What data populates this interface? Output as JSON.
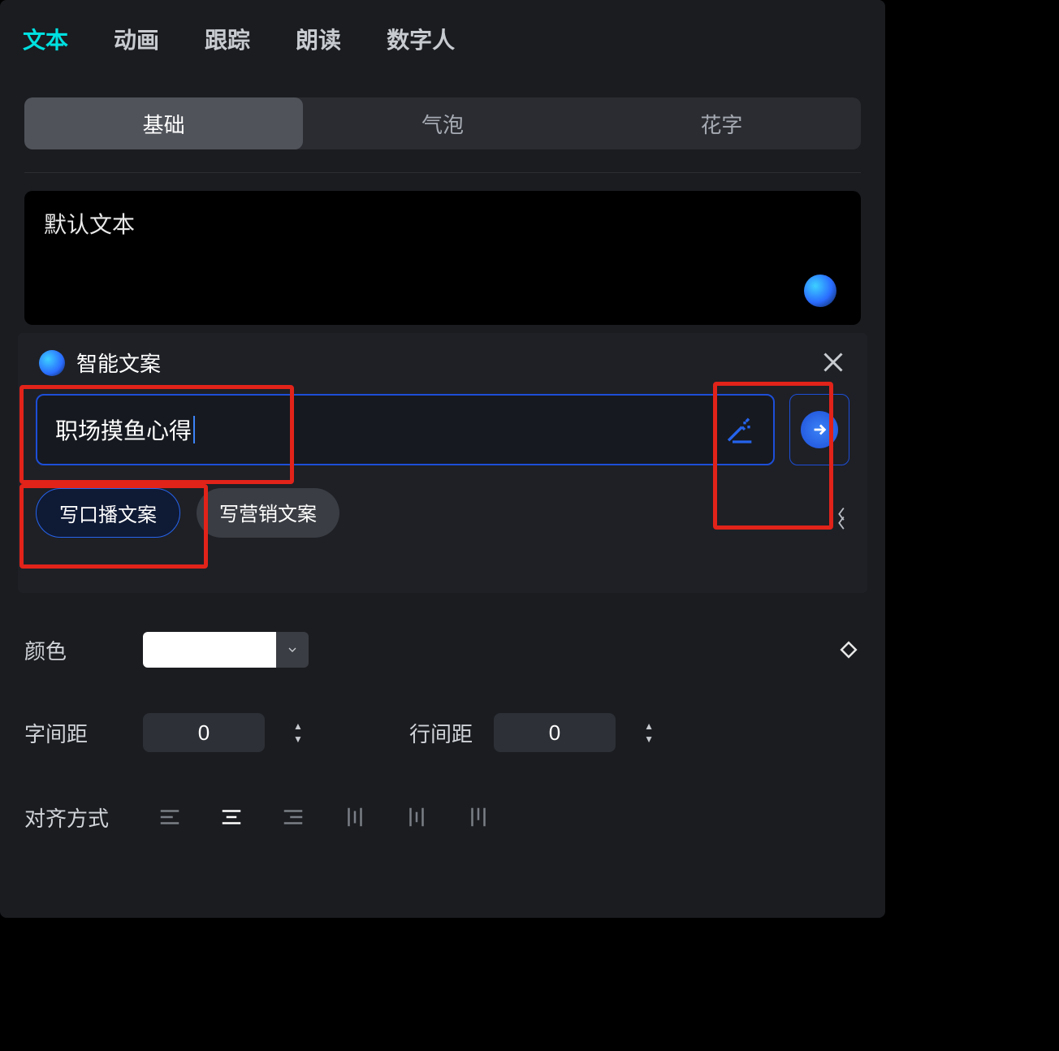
{
  "topTabs": {
    "text": "文本",
    "animation": "动画",
    "track": "跟踪",
    "read": "朗读",
    "avatar": "数字人"
  },
  "subTabs": {
    "basic": "基础",
    "bubble": "气泡",
    "fancy": "花字"
  },
  "textbox": {
    "placeholder": "默认文本"
  },
  "smart": {
    "title": "智能文案",
    "prompt": "职场摸鱼心得",
    "chip_broadcast": "写口播文案",
    "chip_marketing": "写营销文案"
  },
  "form": {
    "color_label": "颜色",
    "letter_spacing_label": "字间距",
    "letter_spacing_value": "0",
    "line_spacing_label": "行间距",
    "line_spacing_value": "0",
    "align_label": "对齐方式"
  },
  "colors": {
    "accent": "#00e0e0",
    "primary_blue": "#2563eb",
    "highlight_red": "#e1231a"
  }
}
